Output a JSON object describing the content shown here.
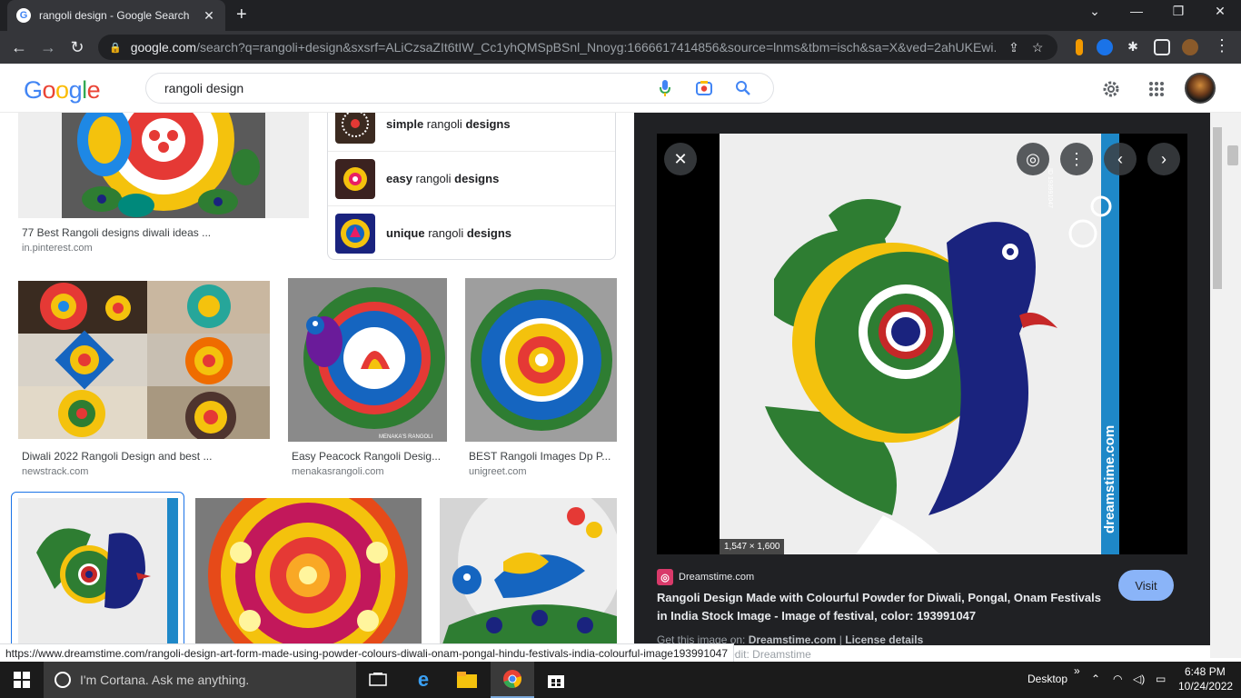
{
  "browser": {
    "tab_title": "rangoli design - Google Search",
    "favicon": "G",
    "url_host": "google.com",
    "url_rest": "/search?q=rangoli+design&sxsrf=ALiCzsaZIt6tIW_Cc1yhQMSpBSnl_Nnoyg:1666617414856&source=lnms&tbm=isch&sa=X&ved=2ahUKEwi..."
  },
  "search": {
    "query": "rangoli design"
  },
  "results": {
    "top_left": {
      "title": "77 Best Rangoli designs diwali ideas ...",
      "site": "in.pinterest.com"
    },
    "related": [
      {
        "prefix": "simple",
        "middle": " rangoli ",
        "suffix": "designs"
      },
      {
        "prefix": "easy",
        "middle": " rangoli ",
        "suffix": "designs"
      },
      {
        "prefix": "unique",
        "middle": " rangoli ",
        "suffix": "designs"
      }
    ],
    "row2": [
      {
        "title": "Diwali 2022 Rangoli Design and best ...",
        "site": "newstrack.com"
      },
      {
        "title": "Easy Peacock Rangoli Desig...",
        "site": "menakasrangoli.com"
      },
      {
        "title": "BEST Rangoli Images Dp P...",
        "site": "unigreet.com"
      }
    ],
    "peacock_watermark": "MENAKA'S RANGOLI"
  },
  "preview": {
    "dimensions": "1,547 × 1,600",
    "site_name": "Dreamstime.com",
    "title": "Rangoli Design Made with Colourful Powder for Diwali, Pongal, Onam Festivals in India Stock Image - Image of festival, color: 193991047",
    "visit_label": "Visit",
    "get_prefix": "Get this image on: ",
    "get_site": "Dreamstime.com",
    "get_sep": " | ",
    "license": "License details",
    "credit": "ge Factory | Credit: Dreamstime",
    "watermark_side": "dreamstime.com",
    "side_id": "ID 193991047"
  },
  "status_link": "https://www.dreamstime.com/rangoli-design-art-form-made-using-powder-colours-diwali-onam-pongal-hindu-festivals-india-colourful-image193991047",
  "taskbar": {
    "cortana_text": "I'm Cortana. Ask me anything.",
    "desktop_label": "Desktop",
    "time": "6:48 PM",
    "date": "10/24/2022"
  }
}
